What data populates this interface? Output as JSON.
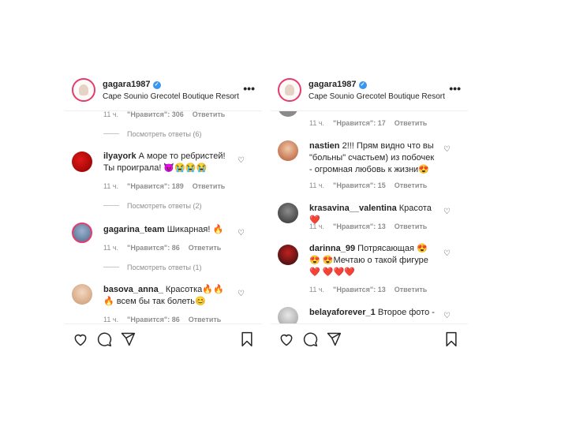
{
  "post": {
    "username": "gagara1987",
    "location": "Cape Sounio Grecotel Boutique Resort",
    "more_label": "•••"
  },
  "left": {
    "comments": [
      {
        "meta": {
          "time": "11 ч.",
          "likes": "\"Нравится\": 306",
          "reply": "Ответить"
        },
        "replies_label": "Посмотреть ответы (6)"
      },
      {
        "user": "ilyayork",
        "text": "А море то ребристей! Ты проиграла! 😈😭😭😭",
        "meta": {
          "time": "11 ч.",
          "likes": "\"Нравится\": 189",
          "reply": "Ответить"
        },
        "replies_label": "Посмотреть ответы (2)"
      },
      {
        "user": "gagarina_team",
        "text": "Шикарная! 🔥",
        "meta": {
          "time": "11 ч.",
          "likes": "\"Нравится\": 86",
          "reply": "Ответить"
        },
        "replies_label": "Посмотреть ответы (1)"
      },
      {
        "user": "basova_anna_",
        "text": "Красотка🔥🔥🔥 всем бы так болеть😊",
        "meta": {
          "time": "11 ч.",
          "likes": "\"Нравится\": 86",
          "reply": "Ответить"
        }
      }
    ]
  },
  "right": {
    "comments": [
      {
        "meta": {
          "time": "11 ч.",
          "likes": "\"Нравится\": 17",
          "reply": "Ответить"
        }
      },
      {
        "user": "nastien",
        "text": "2!!! Прям видно что вы \"больны\" счастьем) из побочек - огромная любовь к жизни😍",
        "meta": {
          "time": "11 ч.",
          "likes": "\"Нравится\": 15",
          "reply": "Ответить"
        }
      },
      {
        "user": "krasavina__valentina",
        "text": "Красота❤️",
        "meta": {
          "time": "11 ч.",
          "likes": "\"Нравится\": 13",
          "reply": "Ответить"
        }
      },
      {
        "user": "darinna_99",
        "text": "Потрясающая 😍😍 😍Мечтаю о такой фигуре ❤️ ❤️❤️❤️",
        "meta": {
          "time": "11 ч.",
          "likes": "\"Нравится\": 13",
          "reply": "Ответить"
        }
      },
      {
        "user": "belayaforever_1",
        "text": "Второе фото -"
      }
    ]
  },
  "icons": {
    "heart": "heart-icon",
    "comment": "comment-icon",
    "share": "share-icon",
    "save": "bookmark-icon",
    "verified": "verified-badge-icon"
  },
  "colors": {
    "verified": "#3897f0",
    "muted": "#8e8e8e",
    "text": "#262626",
    "story_ring": "#e23d6c"
  }
}
